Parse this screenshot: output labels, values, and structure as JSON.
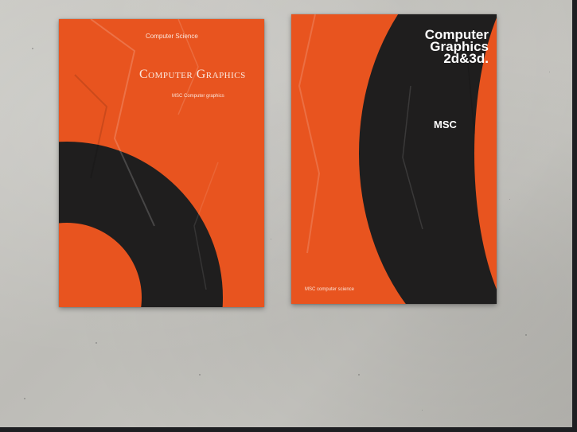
{
  "scene": {
    "colors": {
      "poster_orange": "#e8541f",
      "poster_black": "#1f1e1e",
      "wall": "#c4c3be"
    }
  },
  "poster_left": {
    "top_text": "Computer Science",
    "title": "Computer Graphics",
    "subtitle": "MSC Computer graphics"
  },
  "poster_right": {
    "title": "Computer\nGraphics\n2d&3d.",
    "badge": "MSC",
    "footer": "MSC computer science"
  }
}
